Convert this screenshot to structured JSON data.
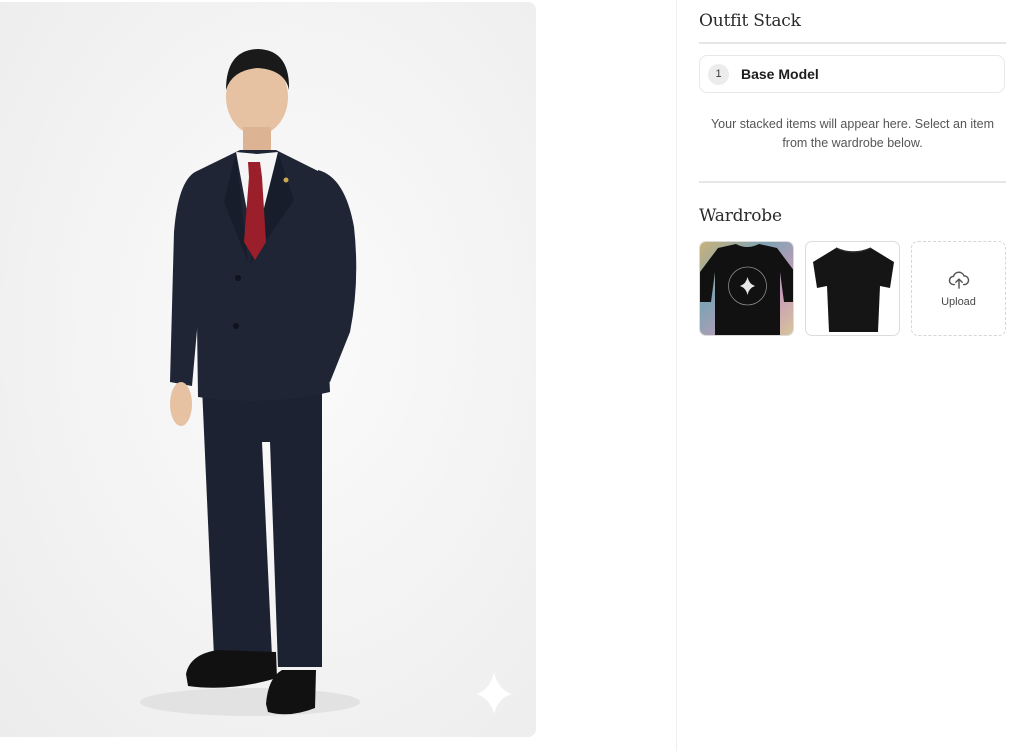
{
  "outfit_stack": {
    "title": "Outfit Stack",
    "items": [
      {
        "index": "1",
        "label": "Base Model"
      }
    ],
    "empty_message": "Your stacked items will appear here. Select an item from the wardrobe below."
  },
  "wardrobe": {
    "title": "Wardrobe",
    "items": [
      {
        "name": "graphic long sleeve tee"
      },
      {
        "name": "black oversized tee"
      }
    ],
    "upload_label": "Upload"
  },
  "colors": {
    "suit": "#1f2535",
    "tie": "#9b1f2a",
    "background": "#f3f3f3"
  }
}
